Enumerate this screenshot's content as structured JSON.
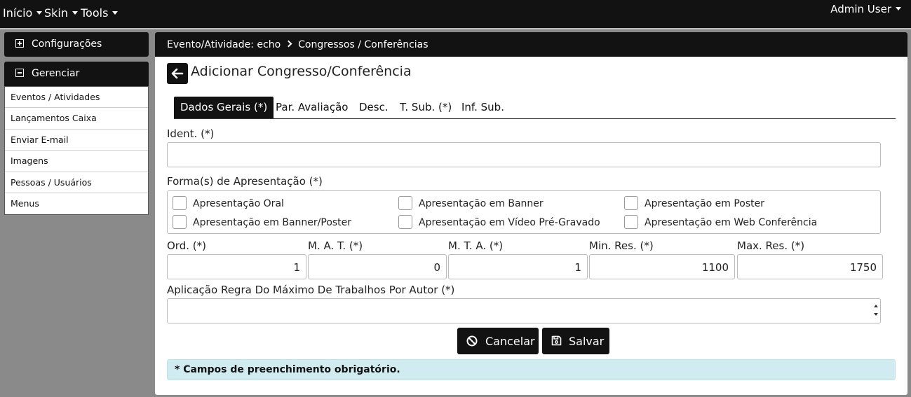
{
  "navbar": {
    "items": [
      {
        "label": "Início"
      },
      {
        "label": "Skin"
      },
      {
        "label": "Tools"
      }
    ],
    "user_label": "Admin User"
  },
  "sidebar": {
    "sections": [
      {
        "label": "Configurações",
        "icon": "plus-square-icon"
      },
      {
        "label": "Gerenciar",
        "icon": "minus-square-icon"
      }
    ],
    "links": [
      {
        "label": "Eventos / Atividades"
      },
      {
        "label": "Lançamentos Caixa"
      },
      {
        "label": "Enviar E-mail"
      },
      {
        "label": "Imagens"
      },
      {
        "label": "Pessoas / Usuários"
      },
      {
        "label": "Menus"
      }
    ]
  },
  "breadcrumb": {
    "event": "Evento/Atividade: echo",
    "current": "Congressos / Conferências"
  },
  "page": {
    "title": "Adicionar Congresso/Conferência"
  },
  "tabs": [
    {
      "label": "Dados Gerais (*)",
      "active": true
    },
    {
      "label": "Par. Avaliação",
      "active": false
    },
    {
      "label": "Desc.",
      "active": false
    },
    {
      "label": "T. Sub. (*)",
      "active": false
    },
    {
      "label": "Inf. Sub.",
      "active": false
    }
  ],
  "form": {
    "ident": {
      "label": "Ident. (*)",
      "value": ""
    },
    "formas": {
      "label": "Forma(s) de Apresentação (*)",
      "options": [
        {
          "label": "Apresentação Oral",
          "checked": false
        },
        {
          "label": "Apresentação em Banner",
          "checked": false
        },
        {
          "label": "Apresentação em Poster",
          "checked": false
        },
        {
          "label": "Apresentação em Banner/Poster",
          "checked": false
        },
        {
          "label": "Apresentação em Vídeo Pré-Gravado",
          "checked": false
        },
        {
          "label": "Apresentação em Web Conferência",
          "checked": false
        }
      ]
    },
    "numeric_fields": [
      {
        "label": "Ord. (*)",
        "value": "1"
      },
      {
        "label": "M. A. T. (*)",
        "value": "0"
      },
      {
        "label": "M. T. A. (*)",
        "value": "1"
      },
      {
        "label": "Min. Res. (*)",
        "value": "1100"
      },
      {
        "label": "Max. Res. (*)",
        "value": "1750"
      }
    ],
    "regra": {
      "label": "Aplicação Regra Do Máximo De Trabalhos Por Autor (*)",
      "value": ""
    }
  },
  "actions": {
    "cancel_label": "Cancelar",
    "save_label": "Salvar"
  },
  "notice": "* Campos de preenchimento obrigatório.",
  "colors": {
    "dark": "#121212",
    "info_bg": "#d1ecf1",
    "page_bg": "#8a8a8a"
  }
}
